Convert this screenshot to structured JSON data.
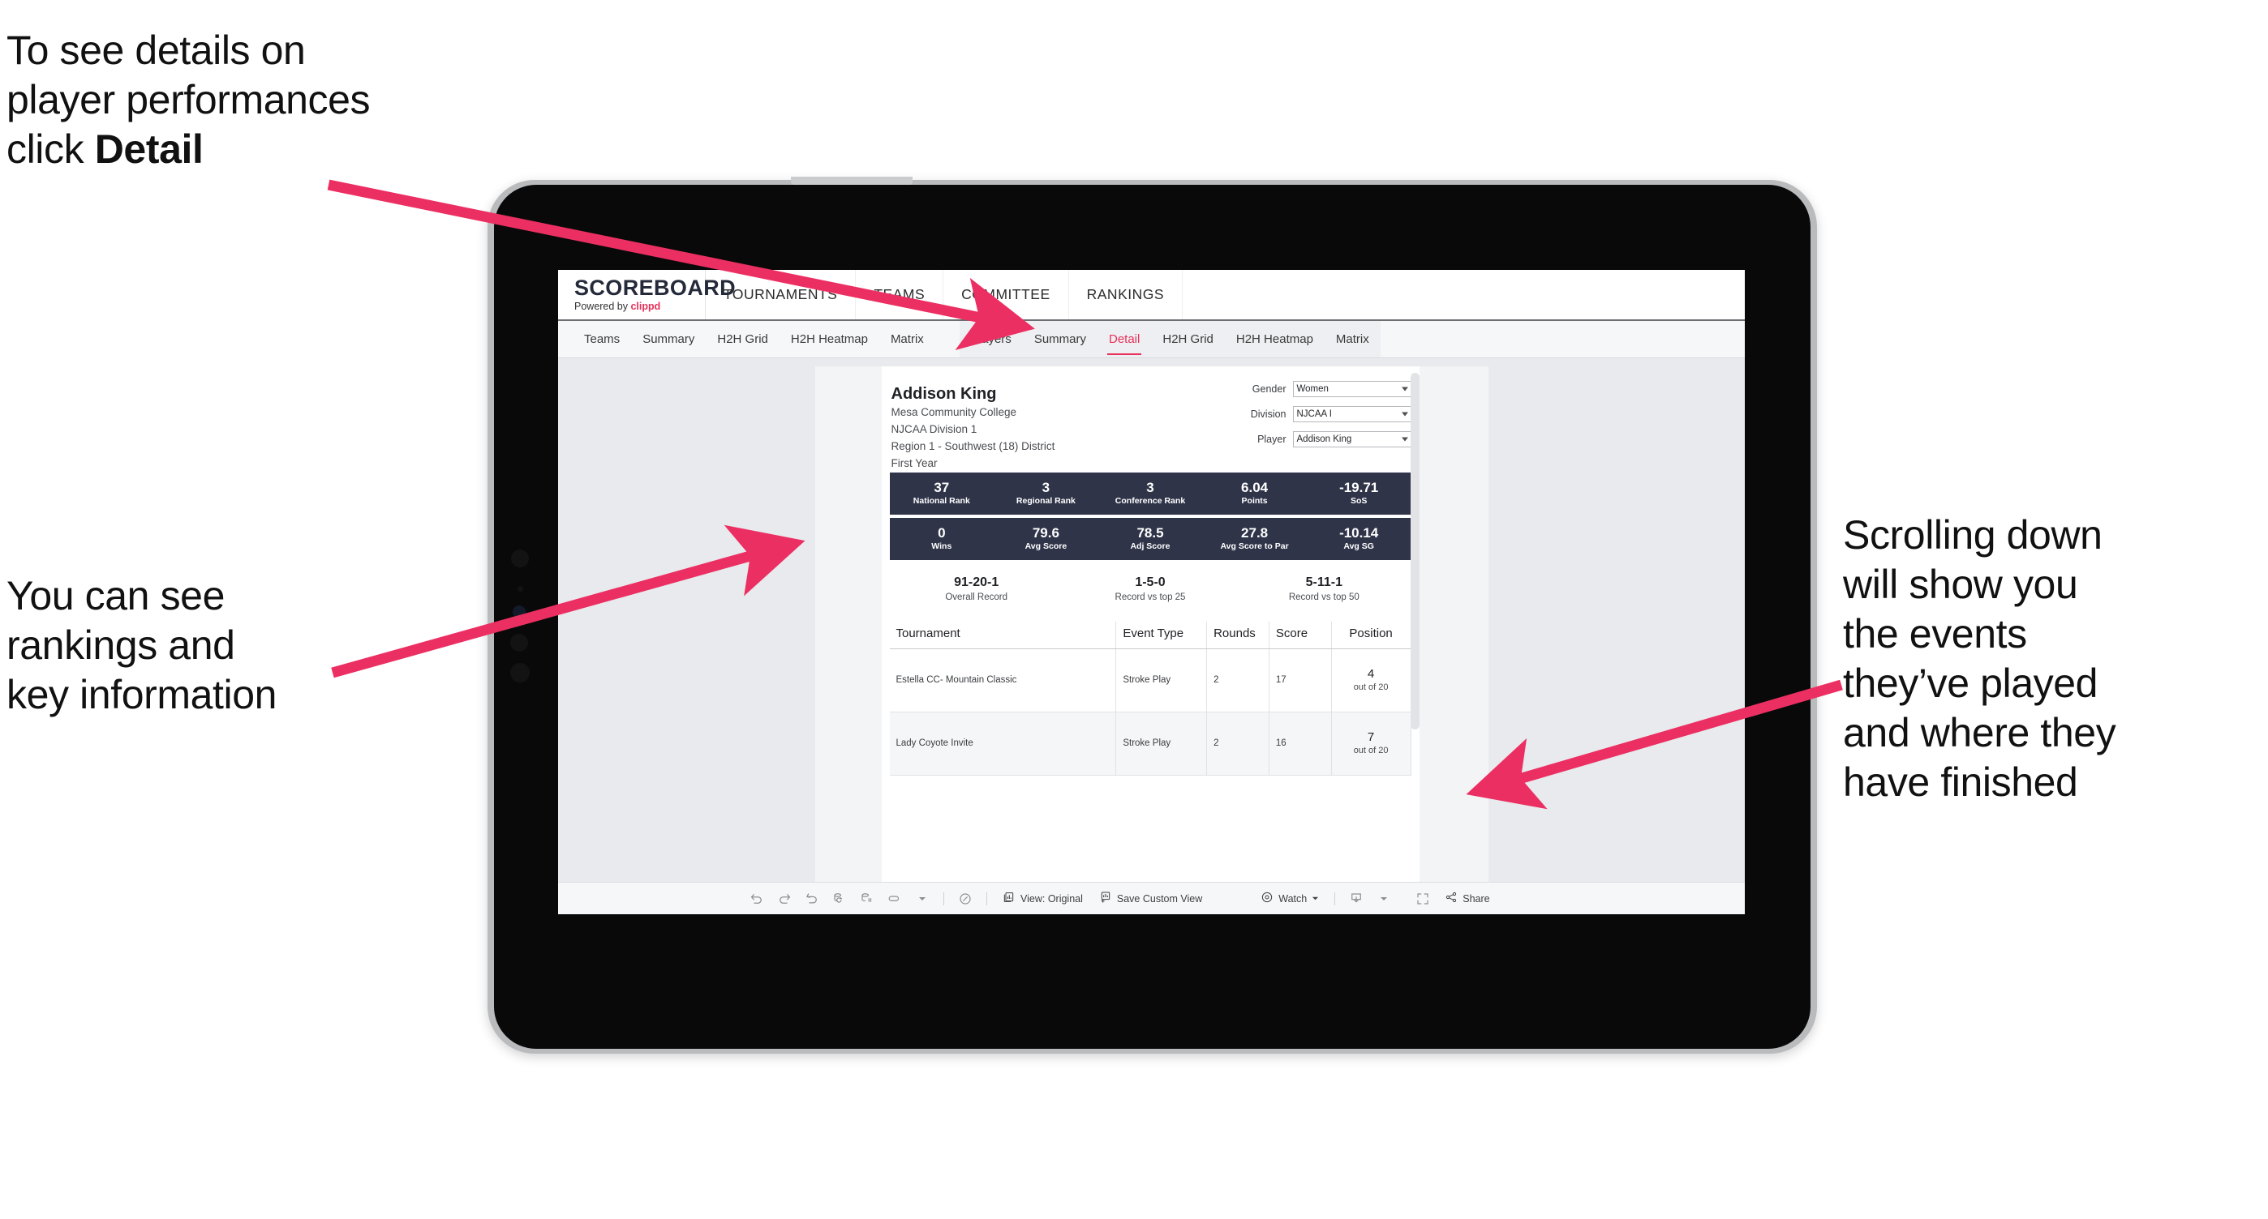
{
  "annotations": {
    "top_left": {
      "line1": "To see details on",
      "line2": "player performances",
      "line3_prefix": "click ",
      "line3_bold": "Detail"
    },
    "mid_left": {
      "line1": "You can see",
      "line2": "rankings and",
      "line3": "key information"
    },
    "right": {
      "line1": "Scrolling down",
      "line2": "will show you",
      "line3": "the events",
      "line4": "they’ve played",
      "line5": "and where they",
      "line6": "have finished"
    }
  },
  "app": {
    "logo": {
      "title": "SCOREBOARD",
      "powered_prefix": "Powered by ",
      "brand": "clippd"
    },
    "top_nav": [
      {
        "label": "TOURNAMENTS"
      },
      {
        "label": "TEAMS"
      },
      {
        "label": "COMMITTEE"
      },
      {
        "label": "RANKINGS"
      }
    ],
    "sub_tabs_teams": [
      {
        "label": "Teams",
        "active": false
      },
      {
        "label": "Summary",
        "active": false
      },
      {
        "label": "H2H Grid",
        "active": false
      },
      {
        "label": "H2H Heatmap",
        "active": false
      },
      {
        "label": "Matrix",
        "active": false
      }
    ],
    "sub_tabs_players": [
      {
        "label": "Players",
        "active": false
      },
      {
        "label": "Summary",
        "active": false
      },
      {
        "label": "Detail",
        "active": true
      },
      {
        "label": "H2H Grid",
        "active": false
      },
      {
        "label": "H2H Heatmap",
        "active": false
      },
      {
        "label": "Matrix",
        "active": false
      }
    ]
  },
  "player": {
    "name": "Addison King",
    "school": "Mesa Community College",
    "division": "NJCAA Division 1",
    "region": "Region 1 - Southwest (18) District",
    "year": "First Year"
  },
  "filters": [
    {
      "label": "Gender",
      "value": "Women"
    },
    {
      "label": "Division",
      "value": "NJCAA I"
    },
    {
      "label": "Player",
      "value": "Addison King"
    }
  ],
  "stats_row_1": [
    {
      "value": "37",
      "label": "National Rank"
    },
    {
      "value": "3",
      "label": "Regional Rank"
    },
    {
      "value": "3",
      "label": "Conference Rank"
    },
    {
      "value": "6.04",
      "label": "Points"
    },
    {
      "value": "-19.71",
      "label": "SoS"
    }
  ],
  "stats_row_2": [
    {
      "value": "0",
      "label": "Wins"
    },
    {
      "value": "79.6",
      "label": "Avg Score"
    },
    {
      "value": "78.5",
      "label": "Adj Score"
    },
    {
      "value": "27.8",
      "label": "Avg Score to Par"
    },
    {
      "value": "-10.14",
      "label": "Avg SG"
    }
  ],
  "records": [
    {
      "value": "91-20-1",
      "label": "Overall Record"
    },
    {
      "value": "1-5-0",
      "label": "Record vs top 25"
    },
    {
      "value": "5-11-1",
      "label": "Record vs top 50"
    }
  ],
  "events_table": {
    "headers": [
      "Tournament",
      "Event Type",
      "Rounds",
      "Score",
      "Position"
    ],
    "rows": [
      {
        "tournament": "Estella CC- Mountain Classic",
        "event_type": "Stroke Play",
        "rounds": "2",
        "score": "17",
        "position": "4",
        "position_of": "out of 20"
      },
      {
        "tournament": "Lady Coyote Invite",
        "event_type": "Stroke Play",
        "rounds": "2",
        "score": "16",
        "position": "7",
        "position_of": "out of 20"
      }
    ]
  },
  "toolbar": {
    "view_label": "View: Original",
    "save_view_label": "Save Custom View",
    "watch_label": "Watch",
    "share_label": "Share"
  },
  "colors": {
    "accent_pink": "#e8305a",
    "stat_panel": "#2f3449",
    "dash_bg": "#e8eaed"
  }
}
